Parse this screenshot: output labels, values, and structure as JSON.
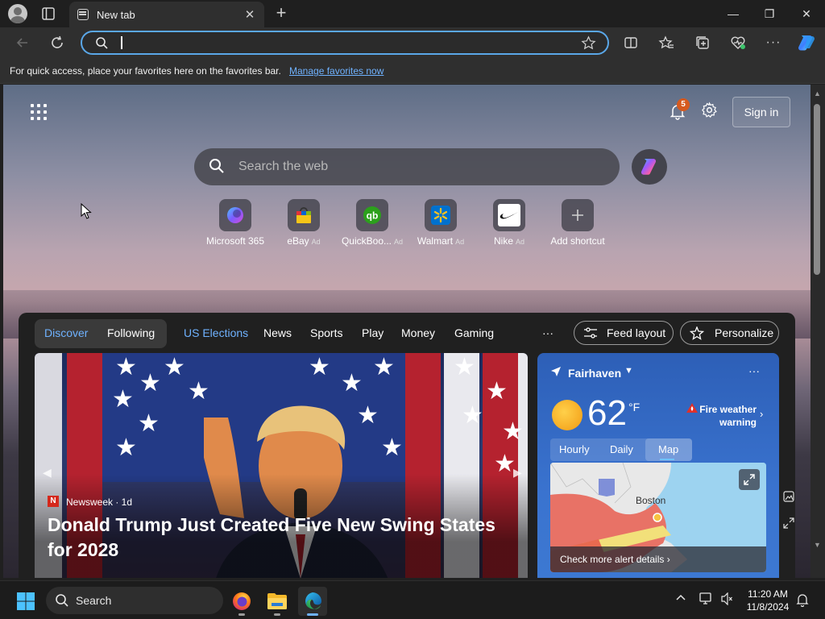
{
  "browser": {
    "tab_title": "New tab",
    "new_tab_symbol": "+",
    "close_tab_symbol": "✕",
    "window": {
      "minimize": "—",
      "restore": "❐",
      "close": "✕"
    },
    "address_bar": {
      "value": "",
      "placeholder": ""
    },
    "favorites_bar": {
      "message": "For quick access, place your favorites here on the favorites bar.",
      "link": "Manage favorites now"
    }
  },
  "newtab": {
    "notification_count": "5",
    "sign_in": "Sign in",
    "search_placeholder": "Search the web",
    "shortcuts": [
      {
        "label": "Microsoft 365",
        "ad": ""
      },
      {
        "label": "eBay",
        "ad": "Ad"
      },
      {
        "label": "QuickBoo...",
        "ad": "Ad"
      },
      {
        "label": "Walmart",
        "ad": "Ad"
      },
      {
        "label": "Nike",
        "ad": "Ad"
      },
      {
        "label": "Add shortcut",
        "ad": ""
      }
    ]
  },
  "feed": {
    "tabs": [
      "Discover",
      "Following",
      "US Elections",
      "News",
      "Sports",
      "Play",
      "Money",
      "Gaming"
    ],
    "more": "···",
    "feed_layout": "Feed layout",
    "personalize": "Personalize",
    "hero": {
      "source": "Newsweek · 1d",
      "headline": "Donald Trump Just Created Five New Swing States for 2028"
    },
    "weather": {
      "location": "Fairhaven",
      "temperature": "62",
      "unit": "°F",
      "alert": "Fire weather warning",
      "tabs": [
        "Hourly",
        "Daily",
        "Map"
      ],
      "active_tab": "Map",
      "map_city": "Boston",
      "map_cta": "Check more alert details ›"
    }
  },
  "taskbar": {
    "search_label": "Search",
    "time": "11:20 AM",
    "date": "11/8/2024"
  },
  "colors": {
    "accent": "#6fb2ff",
    "address_border": "#5aa7e8",
    "badge": "#d65a1f",
    "weather_card": "#3a73cf"
  }
}
